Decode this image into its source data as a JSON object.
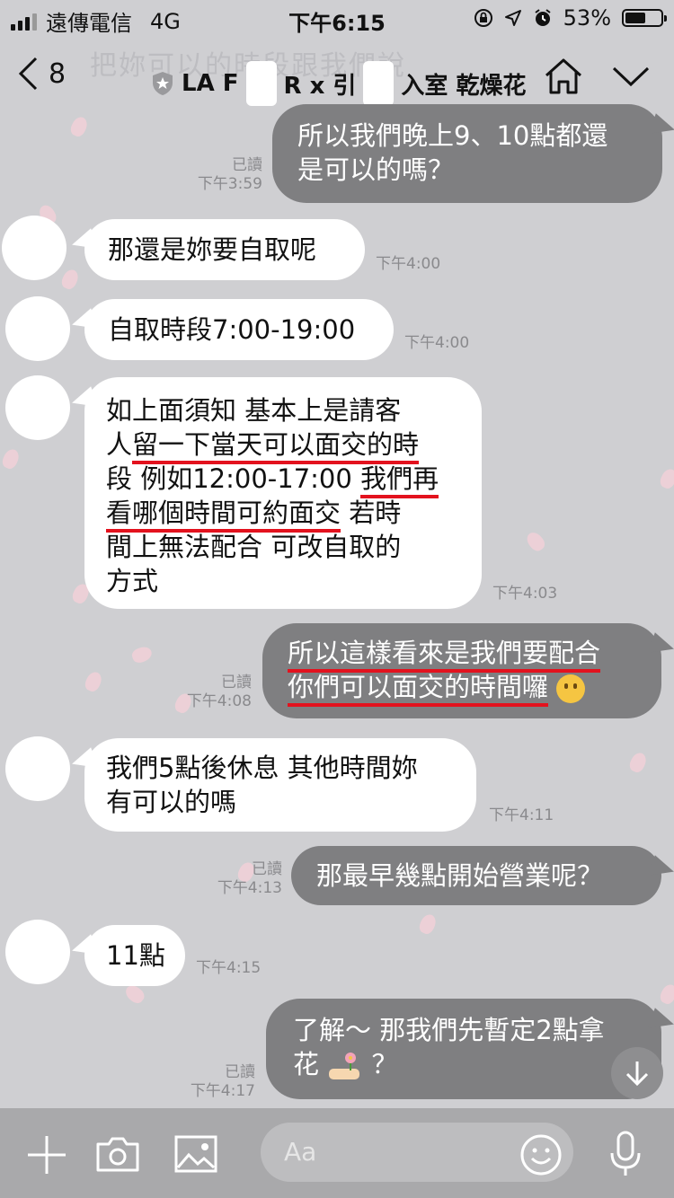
{
  "status_bar": {
    "carrier": "遠傳電信",
    "network": "4G",
    "time": "下午6:15",
    "battery": "53%",
    "battery_level": 0.53
  },
  "header": {
    "back_count": "8",
    "title_part1": "LA F",
    "title_part2": "R x 引",
    "title_part3": "入室 乾燥花",
    "ghost_text": "把妳可以的時段跟我們說"
  },
  "messages": [
    {
      "side": "out",
      "line1": "所以我們晚上9、10點都還",
      "line2": "是可以的嗎？",
      "read": "已讀",
      "time": "下午3:59"
    },
    {
      "side": "in",
      "text": "那還是妳要自取呢",
      "time": "下午4:00"
    },
    {
      "side": "in",
      "text": "自取時段7:00-19:00",
      "time": "下午4:00"
    },
    {
      "side": "in",
      "line1": "如上面須知 基本上是請客",
      "line2a": "人",
      "line2b": "留一下當天可以面交的時",
      "line3a": "段 例如12:00-17:00 ",
      "line3b": "我們再",
      "line4a": "看哪個時間可約面交",
      "line4b": " 若時",
      "line5": "間上無法配合 可改自取的",
      "line6": "方式",
      "time": "下午4:03"
    },
    {
      "side": "out",
      "line1": "所以這樣看來是我們要配合",
      "line2": "你們可以面交的時間囉",
      "read": "已讀",
      "time": "下午4:08"
    },
    {
      "side": "in",
      "line1": "我們5點後休息 其他時間妳",
      "line2": "有可以的嗎",
      "time": "下午4:11"
    },
    {
      "side": "out",
      "text": "那最早幾點開始營業呢？",
      "read": "已讀",
      "time": "下午4:13"
    },
    {
      "side": "in",
      "text": "11點",
      "time": "下午4:15"
    },
    {
      "side": "out",
      "line1": "了解～ 那我們先暫定2點拿",
      "line2a": "花",
      "line2b": "？",
      "read": "已讀",
      "time": "下午4:17"
    }
  ],
  "input": {
    "placeholder": "Aa"
  },
  "icons": {
    "add": "plus-icon",
    "camera": "camera-icon",
    "image": "image-icon",
    "emoji": "smiley-icon",
    "mic": "microphone-icon",
    "scroll": "arrow-down-icon"
  }
}
